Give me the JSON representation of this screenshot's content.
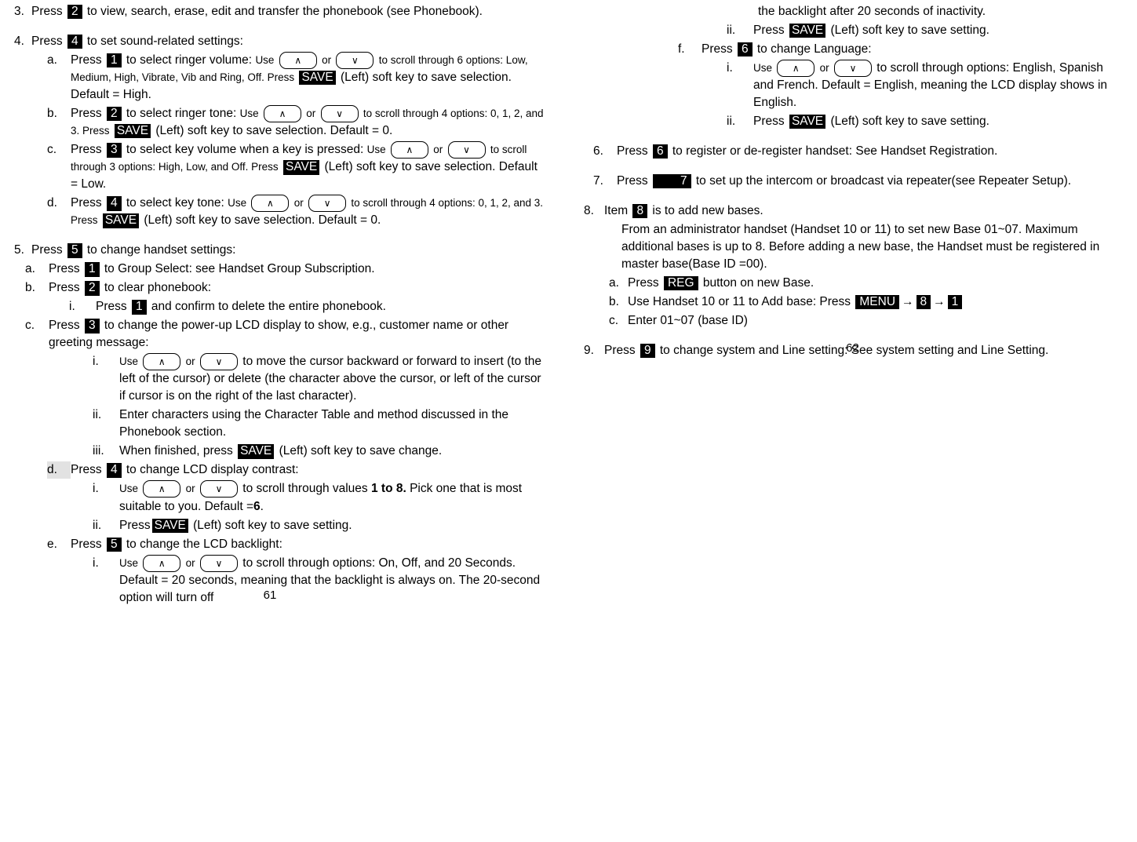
{
  "document": {
    "left_page_number": "61",
    "right_page_number": "62",
    "keys": {
      "k1": "1",
      "k2": "2",
      "k3": "3",
      "k4": "4",
      "k5": "5",
      "k6": "6",
      "k7": "7",
      "k8": "8",
      "k9": "9",
      "save": "SAVE",
      "reg": "REG",
      "menu": "MENU",
      "up": "∧",
      "down": "∨",
      "arrow_right": "→"
    },
    "left": {
      "item3": {
        "label": "3.",
        "text_a": "Press",
        "text_b": "to view, search, erase, edit and transfer the phonebook (see Phonebook)."
      },
      "item4": {
        "label": "4.",
        "text_a": "Press",
        "text_b": "to set sound-related settings:",
        "a": {
          "label": "a.",
          "t1": "Press",
          "t2": "to select ringer volume:",
          "t3": "Use",
          "t4": "or",
          "t5": "to scroll through 6 options: Low, Medium, High, Vibrate, Vib and Ring, Off.  Press",
          "t6": "(Left) soft key to save selection.  Default = High."
        },
        "b": {
          "label": "b.",
          "t1": "Press",
          "t2": "to select ringer tone:",
          "t3": "Use",
          "t4": "or",
          "t5": "to scroll through 4 options: 0, 1, 2, and 3.  Press",
          "t6": "(Left) soft key to save selection.  Default = 0."
        },
        "c": {
          "label": "c.",
          "t1": "Press",
          "t2": "to select key volume when a key is pressed:",
          "t3": "Use",
          "t4": "or",
          "t5": "to scroll through 3 options: High, Low, and Off.  Press",
          "t6": "(Left) soft key to save selection.  Default = Low."
        },
        "d": {
          "label": "d.",
          "t1": "Press",
          "t2": "to select key tone:",
          "t3": "Use",
          "t4": "or",
          "t5": "to scroll through 4 options: 0, 1, 2, and 3.  Press",
          "t6": "(Left) soft key to save selection.  Default = 0."
        }
      },
      "item5": {
        "label": "5.",
        "text_a": "Press",
        "text_b": "to change handset settings:",
        "a": {
          "label": "a.",
          "t1": "Press",
          "t2": "to Group Select: see Handset Group Subscription."
        },
        "b": {
          "label": "b.",
          "t1": "Press",
          "t2": "to clear phonebook:",
          "i": {
            "label": "i.",
            "t1": "Press",
            "t2": "and confirm to delete the entire phonebook."
          }
        },
        "c": {
          "label": "c.",
          "t1": "Press",
          "t2": "to change the power-up LCD display to show, e.g., customer name or other greeting message:",
          "i": {
            "label": "i.",
            "t1": "Use",
            "t2": "or",
            "t3": "to move the cursor backward or forward to insert (to the left of the cursor) or delete (the character above the cursor, or left of the cursor if cursor is on the right of the last character)."
          },
          "ii": {
            "label": "ii.",
            "t1": "Enter characters using the Character Table and method discussed in the Phonebook section."
          },
          "iii": {
            "label": "iii.",
            "t1": "When finished, press",
            "t2": "(Left) soft key to save change."
          }
        },
        "d": {
          "label": "d.",
          "t1": "Press",
          "t2": "to change LCD display contrast:",
          "i": {
            "label": "i.",
            "t1": "Use",
            "t2": "or",
            "t3": "to scroll through values",
            "t4": "1 to 8.",
            "t5": "Pick one that is most suitable to you.  Default =",
            "t6": "6",
            "t7": "."
          },
          "ii": {
            "label": "ii.",
            "t1": "Press",
            "t2": "(Left) soft key to save setting."
          }
        },
        "e": {
          "label": "e.",
          "t1": "Press",
          "t2": "to change the LCD backlight:",
          "i": {
            "label": "i.",
            "t1": "Use",
            "t2": "or",
            "t3": "to scroll through options: On, Off, and 20 Seconds.  Default = 20 seconds, meaning that the backlight is always on.  The 20-second option will turn off"
          }
        }
      }
    },
    "right": {
      "cont": {
        "text": "the backlight after 20 seconds of inactivity.",
        "ii": {
          "label": "ii.",
          "t1": "Press",
          "t2": "(Left) soft key to save setting."
        }
      },
      "f": {
        "label": "f.",
        "t1": "Press",
        "t2": "to change Language:",
        "i": {
          "label": "i.",
          "t1": "Use",
          "t2": "or",
          "t3": "to scroll through options: English, Spanish and French. Default = English, meaning the LCD display shows in English."
        },
        "ii": {
          "label": "ii.",
          "t1": "Press",
          "t2": "(Left) soft key to save setting."
        }
      },
      "item6": {
        "label": "6.",
        "t1": "Press",
        "t2": "to register or de-register handset:  See Handset Registration."
      },
      "item7": {
        "label": "7.",
        "t1": "Press",
        "t2": "to set up the intercom or broadcast via repeater(see Repeater Setup)."
      },
      "item8": {
        "label": "8.",
        "t1": "Item",
        "t2": "is to add new bases.",
        "para": "From an administrator handset (Handset 10 or 11) to set new Base 01~07. Maximum additional bases is up to 8. Before adding a new base, the Handset must be registered in master base(Base ID =00).",
        "a": {
          "label": "a.",
          "t1": "Press",
          "t2": "button on new Base."
        },
        "b": {
          "label": "b.",
          "t1": "Use Handset 10 or 11 to Add base: Press"
        },
        "c": {
          "label": "c.",
          "t1": "Enter 01~07 (base ID)"
        }
      },
      "item9": {
        "label": "9.",
        "t1": "Press",
        "t2": "to change system and Line setting:  See system setting and Line Setting."
      }
    }
  }
}
